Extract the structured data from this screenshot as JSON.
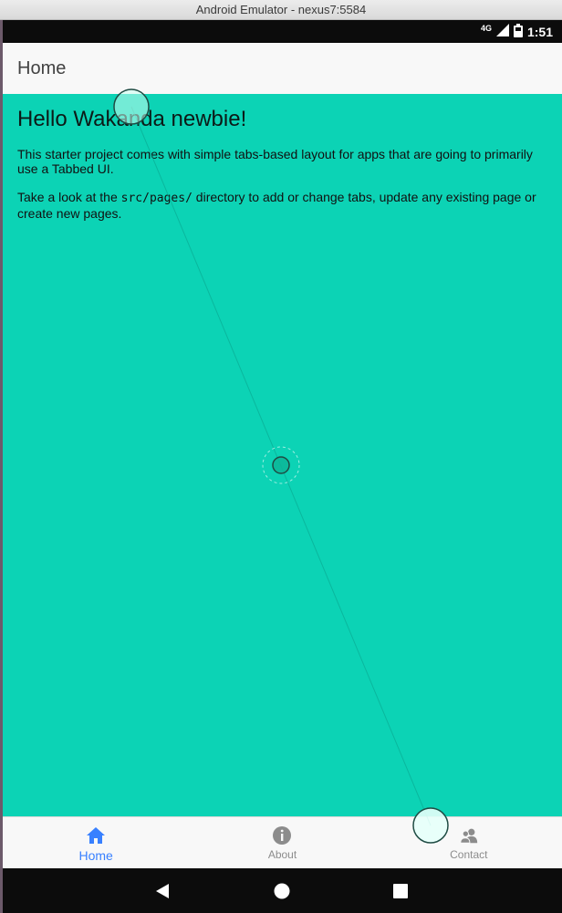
{
  "window": {
    "title": "Android Emulator - nexus7:5584"
  },
  "statusbar": {
    "network": "4G",
    "time": "1:51",
    "background": "#0c0c0c"
  },
  "toolbar": {
    "title": "Home"
  },
  "content": {
    "heading": "Hello Wakanda newbie!",
    "paragraph1": "This starter project comes with simple tabs-based layout for apps that are going to primarily use a Tabbed UI.",
    "paragraph2_prefix": "Take a look at the ",
    "paragraph2_code": "src/pages/",
    "paragraph2_suffix": " directory to add or change tabs, update any existing page or create new pages.",
    "background": "#0cd3b5"
  },
  "tabs": [
    {
      "label": "Home",
      "icon": "home-icon",
      "active": true
    },
    {
      "label": "About",
      "icon": "info-icon",
      "active": false
    },
    {
      "label": "Contact",
      "icon": "contacts-icon",
      "active": false
    }
  ],
  "navbar": {
    "back_icon": "back-triangle-icon",
    "home_icon": "home-circle-icon",
    "recents_icon": "recents-square-icon"
  },
  "colors": {
    "accent": "#3880ff",
    "inactive": "#8c8c8c"
  }
}
